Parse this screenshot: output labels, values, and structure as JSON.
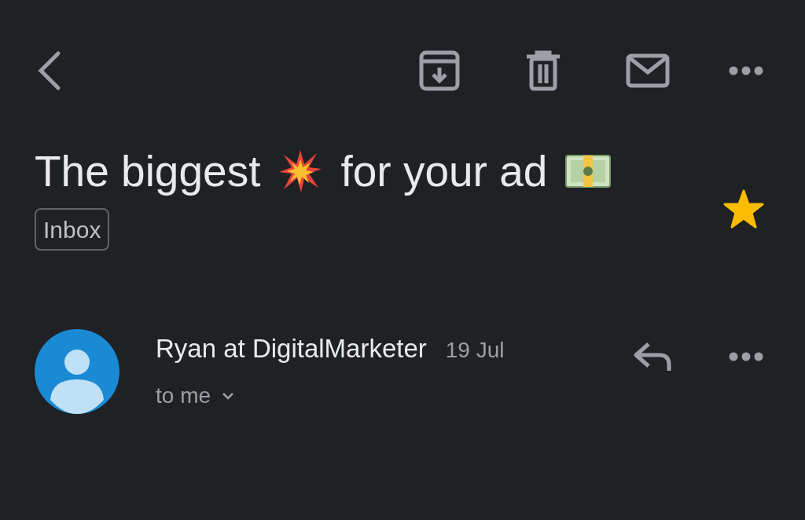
{
  "subject_parts": [
    {
      "kind": "text",
      "text": "The biggest"
    },
    {
      "kind": "collision-emoji"
    },
    {
      "kind": "text",
      "text": "for your ad"
    },
    {
      "kind": "banknote-emoji"
    }
  ],
  "label": "Inbox",
  "starred": true,
  "message": {
    "sender": "Ryan at DigitalMarketer",
    "date": "19 Jul",
    "recipient": "to me"
  }
}
